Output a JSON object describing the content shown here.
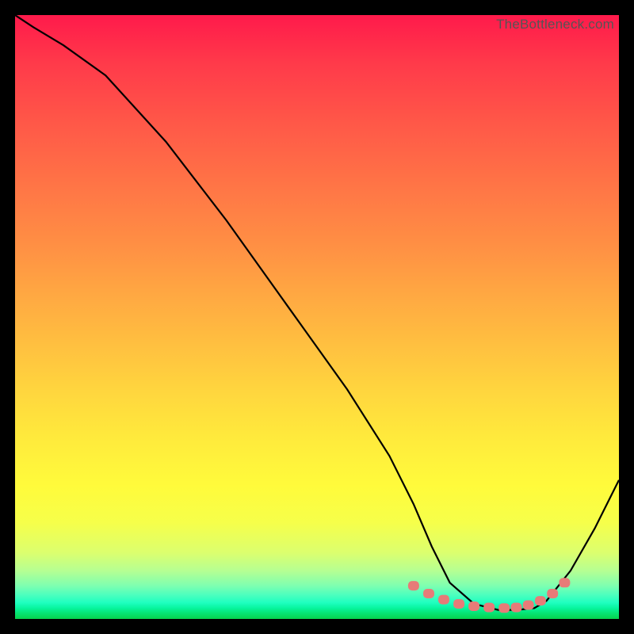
{
  "attribution": "TheBottleneck.com",
  "chart_data": {
    "type": "line",
    "title": "",
    "xlabel": "",
    "ylabel": "",
    "xlim": [
      0,
      100
    ],
    "ylim": [
      0,
      100
    ],
    "series": [
      {
        "name": "bottleneck-curve",
        "x": [
          0,
          3,
          8,
          15,
          25,
          35,
          45,
          55,
          62,
          66,
          69,
          72,
          76,
          80,
          83,
          86,
          88,
          92,
          96,
          100
        ],
        "y": [
          100,
          98,
          95,
          90,
          79,
          66,
          52,
          38,
          27,
          19,
          12,
          6,
          2.5,
          1.5,
          1.5,
          1.8,
          3,
          8,
          15,
          23
        ]
      }
    ],
    "markers": {
      "name": "highlight-band",
      "x": [
        66,
        68.5,
        71,
        73.5,
        76,
        78.5,
        81,
        83,
        85,
        87,
        89,
        91
      ],
      "y": [
        5.5,
        4.2,
        3.2,
        2.5,
        2.1,
        1.9,
        1.8,
        1.9,
        2.3,
        3.0,
        4.2,
        6.0
      ]
    },
    "gradient_stops": [
      {
        "pos": 0,
        "color": "#ff1a4b"
      },
      {
        "pos": 50,
        "color": "#ffbe40"
      },
      {
        "pos": 80,
        "color": "#fffb3b"
      },
      {
        "pos": 97,
        "color": "#1fffc0"
      },
      {
        "pos": 100,
        "color": "#06d24d"
      }
    ]
  }
}
